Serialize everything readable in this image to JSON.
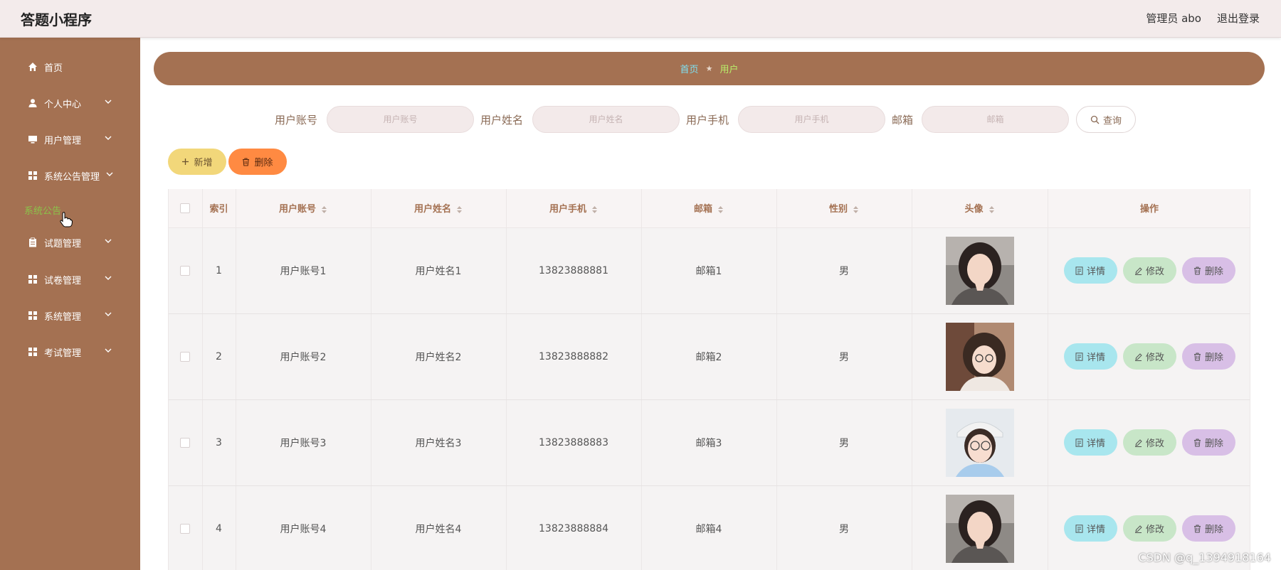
{
  "app": {
    "title": "答题小程序"
  },
  "topbar": {
    "user": "管理员 abo",
    "logout": "退出登录"
  },
  "sidebar": {
    "items": [
      {
        "label": "首页",
        "icon": "home-icon",
        "has_children": false
      },
      {
        "label": "个人中心",
        "icon": "person-icon",
        "has_children": true
      },
      {
        "label": "用户管理",
        "icon": "monitor-icon",
        "has_children": true
      },
      {
        "label": "系统公告管理",
        "icon": "grid-icon",
        "has_children": true
      },
      {
        "label": "试题管理",
        "icon": "clipboard-icon",
        "has_children": true
      },
      {
        "label": "试卷管理",
        "icon": "grid-icon",
        "has_children": true
      },
      {
        "label": "系统管理",
        "icon": "grid-icon",
        "has_children": true
      },
      {
        "label": "考试管理",
        "icon": "grid-icon",
        "has_children": true
      }
    ],
    "submenu": {
      "label": "系统公告"
    }
  },
  "breadcrumb": {
    "home": "首页",
    "separator": "★",
    "current": "用户"
  },
  "search": {
    "fields": [
      {
        "label": "用户账号",
        "placeholder": "用户账号",
        "value": ""
      },
      {
        "label": "用户姓名",
        "placeholder": "用户姓名",
        "value": ""
      },
      {
        "label": "用户手机",
        "placeholder": "用户手机",
        "value": ""
      },
      {
        "label": "邮箱",
        "placeholder": "邮箱",
        "value": ""
      }
    ],
    "query_label": "查询"
  },
  "actions": {
    "add_label": "新增",
    "delete_label": "删除"
  },
  "table": {
    "columns": [
      "索引",
      "用户账号",
      "用户姓名",
      "用户手机",
      "邮箱",
      "性别",
      "头像",
      "操作"
    ],
    "sortable": [
      false,
      true,
      true,
      true,
      true,
      true,
      true,
      false
    ],
    "rows": [
      {
        "index": "1",
        "account": "用户账号1",
        "name": "用户姓名1",
        "phone": "13823888881",
        "email": "邮箱1",
        "gender": "男",
        "avatar": "avatar-photo-1"
      },
      {
        "index": "2",
        "account": "用户账号2",
        "name": "用户姓名2",
        "phone": "13823888882",
        "email": "邮箱2",
        "gender": "男",
        "avatar": "avatar-photo-2"
      },
      {
        "index": "3",
        "account": "用户账号3",
        "name": "用户姓名3",
        "phone": "13823888883",
        "email": "邮箱3",
        "gender": "男",
        "avatar": "avatar-photo-3"
      },
      {
        "index": "4",
        "account": "用户账号4",
        "name": "用户姓名4",
        "phone": "13823888884",
        "email": "邮箱4",
        "gender": "男",
        "avatar": "avatar-photo-4"
      }
    ],
    "row_actions": {
      "detail": "详情",
      "edit": "修改",
      "delete": "删除"
    }
  },
  "watermark": "CSDN @q_1394918164",
  "colors": {
    "sidebar": "#a47152",
    "topbar": "#f3ebeb",
    "accent_link": "#7fe0f0",
    "accent_current": "#b9f06a",
    "add_button": "#f2d77a",
    "delete_button": "#ff8a42",
    "detail_button": "#a8e6ee",
    "edit_button": "#c8e6c8",
    "row_delete_button": "#d8bfe6"
  }
}
